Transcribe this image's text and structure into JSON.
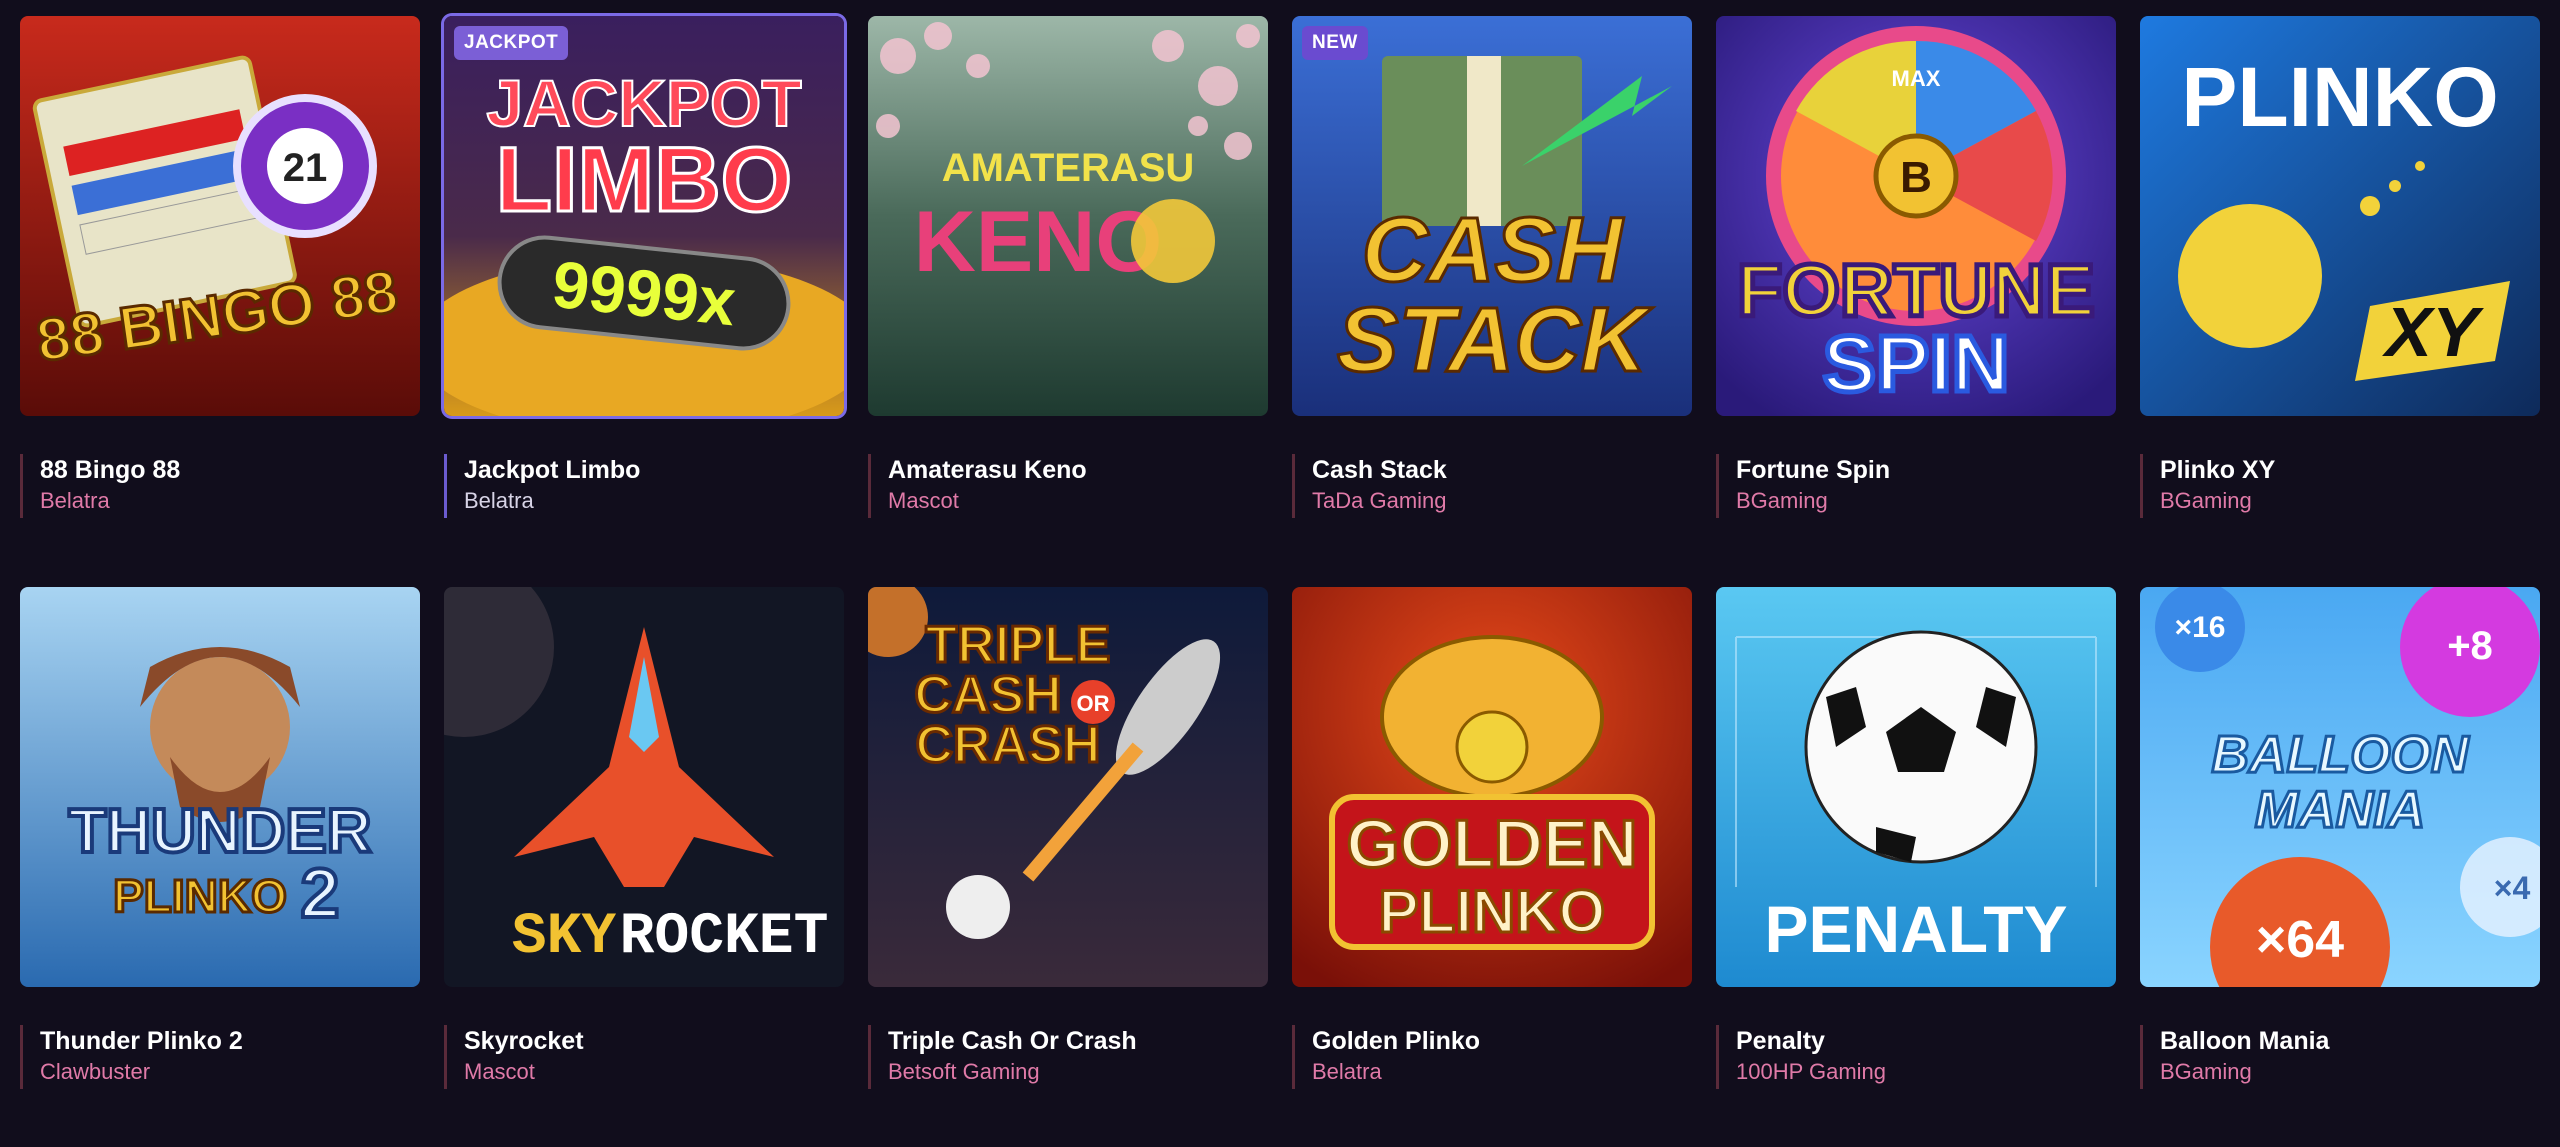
{
  "games": [
    {
      "title": "88 Bingo 88",
      "provider": "Belatra",
      "badge": "",
      "art": [
        "88 BINGO 88",
        "21"
      ]
    },
    {
      "title": "Jackpot Limbo",
      "provider": "Belatra",
      "badge": "JACKPOT",
      "art": [
        "JACKPOT",
        "LIMBO",
        "9999x"
      ]
    },
    {
      "title": "Amaterasu Keno",
      "provider": "Mascot",
      "badge": "",
      "art": [
        "AMATERASU",
        "KENO"
      ]
    },
    {
      "title": "Cash Stack",
      "provider": "TaDa Gaming",
      "badge": "NEW",
      "art": [
        "CASH",
        "STACK"
      ]
    },
    {
      "title": "Fortune Spin",
      "provider": "BGaming",
      "badge": "",
      "art": [
        "FORTUNE",
        "SPIN",
        "B",
        "MAX"
      ]
    },
    {
      "title": "Plinko XY",
      "provider": "BGaming",
      "badge": "",
      "art": [
        "PLINKO",
        "XY"
      ]
    },
    {
      "title": "Thunder Plinko 2",
      "provider": "Clawbuster",
      "badge": "",
      "art": [
        "THUNDER",
        "PLINKO",
        "2"
      ]
    },
    {
      "title": "Skyrocket",
      "provider": "Mascot",
      "badge": "",
      "art": [
        "SKY",
        "ROCKET"
      ]
    },
    {
      "title": "Triple Cash Or Crash",
      "provider": "Betsoft Gaming",
      "badge": "",
      "art": [
        "TRIPLE",
        "CASH",
        "OR",
        "CRASH"
      ]
    },
    {
      "title": "Golden Plinko",
      "provider": "Belatra",
      "badge": "",
      "art": [
        "GOLDEN",
        "PLINKO"
      ]
    },
    {
      "title": "Penalty",
      "provider": "100HP Gaming",
      "badge": "",
      "art": [
        "PENALTY"
      ]
    },
    {
      "title": "Balloon Mania",
      "provider": "BGaming",
      "badge": "",
      "art": [
        "BALLOON",
        "MANIA",
        "×16",
        "+8",
        "×64",
        "×4"
      ]
    }
  ],
  "colors": {
    "accent": "#7b5fd6",
    "provider": "#e07aa8",
    "background": "#110d1c"
  }
}
